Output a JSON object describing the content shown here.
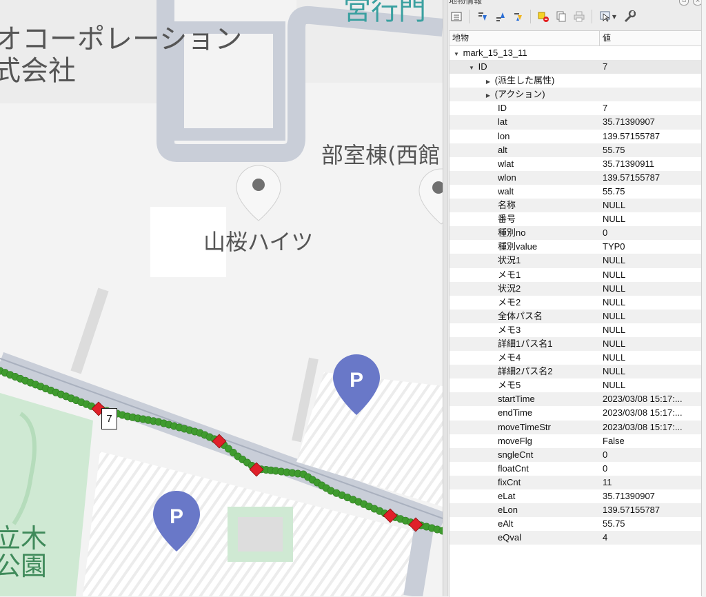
{
  "map": {
    "labels": {
      "station": "宮行門",
      "company_line1": "オコーポレーション",
      "company_line2": "式会社",
      "building_club": "部室棟(西館",
      "building_haitsu": "山桜ハイツ",
      "park_line1": "立木",
      "park_line2": "公園"
    },
    "parking_label": "P",
    "feature_label": "7",
    "colors": {
      "track_point": "#3f9b2e",
      "vertex": "#e0202a",
      "road": "#c9ced8",
      "building": "#dedede",
      "park": "#cfe9d3",
      "poi": "#6978c8"
    }
  },
  "panel": {
    "title": "地物情報",
    "toolbar": {
      "icons": [
        "expand-tree-icon",
        "expand-all-icon",
        "collapse-all-icon",
        "select-icon",
        "clear-highlight-icon",
        "copy-icon",
        "print-icon",
        "identify-mode-icon",
        "settings-icon"
      ]
    },
    "table": {
      "col_attr": "地物",
      "col_value": "値",
      "layer_name": "mark_15_13_11",
      "feature_key": "ID",
      "feature_value": "7",
      "derived_label": "(派生した属性)",
      "actions_label": "(アクション)",
      "rows": [
        {
          "name": "ID",
          "value": "7"
        },
        {
          "name": "lat",
          "value": "35.71390907"
        },
        {
          "name": "lon",
          "value": "139.57155787"
        },
        {
          "name": "alt",
          "value": "55.75"
        },
        {
          "name": "wlat",
          "value": "35.71390911"
        },
        {
          "name": "wlon",
          "value": "139.57155787"
        },
        {
          "name": "walt",
          "value": "55.75"
        },
        {
          "name": "名称",
          "value": "NULL"
        },
        {
          "name": "番号",
          "value": "NULL"
        },
        {
          "name": "種別no",
          "value": "0"
        },
        {
          "name": "種別value",
          "value": "TYP0"
        },
        {
          "name": "状況1",
          "value": "NULL"
        },
        {
          "name": "メモ1",
          "value": "NULL"
        },
        {
          "name": "状況2",
          "value": "NULL"
        },
        {
          "name": "メモ2",
          "value": "NULL"
        },
        {
          "name": "全体パス名",
          "value": "NULL"
        },
        {
          "name": "メモ3",
          "value": "NULL"
        },
        {
          "name": "詳細1パス名1",
          "value": "NULL"
        },
        {
          "name": "メモ4",
          "value": "NULL"
        },
        {
          "name": "詳細2パス名2",
          "value": "NULL"
        },
        {
          "name": "メモ5",
          "value": "NULL"
        },
        {
          "name": "startTime",
          "value": "2023/03/08 15:17:..."
        },
        {
          "name": "endTime",
          "value": "2023/03/08 15:17:..."
        },
        {
          "name": "moveTimeStr",
          "value": "2023/03/08 15:17:..."
        },
        {
          "name": "moveFlg",
          "value": "False"
        },
        {
          "name": "sngleCnt",
          "value": "0"
        },
        {
          "name": "floatCnt",
          "value": "0"
        },
        {
          "name": "fixCnt",
          "value": "11"
        },
        {
          "name": "eLat",
          "value": "35.71390907"
        },
        {
          "name": "eLon",
          "value": "139.57155787"
        },
        {
          "name": "eAlt",
          "value": "55.75"
        },
        {
          "name": "eQval",
          "value": "4"
        }
      ]
    }
  }
}
